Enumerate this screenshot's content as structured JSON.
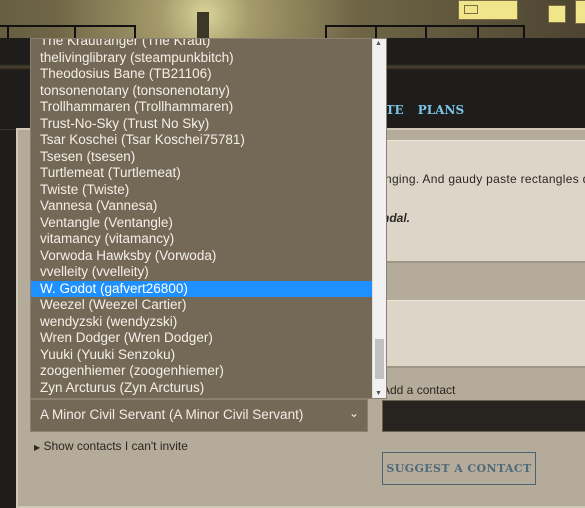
{
  "nav": {
    "items": [
      "ITE",
      "PLANS"
    ]
  },
  "content": {
    "paragraph": "inging. And gaudy paste rectangles di",
    "bold_text": "ndal.",
    "add_contact_label": "Add a contact",
    "suggest_button": "SUGGEST A CONTACT"
  },
  "dropdown": {
    "options": [
      "The Krautranger (The Kraut)",
      "thelivinglibrary (steampunkbitch)",
      "Theodosius Bane (TB21106)",
      "tonsonenotany (tonsonenotany)",
      "Trollhammaren (Trollhammaren)",
      "Trust-No-Sky (Trust No Sky)",
      "Tsar Koschei (Tsar Koschei75781)",
      "Tsesen (tsesen)",
      "Turtlemeat (Turtlemeat)",
      "Twiste (Twiste)",
      "Vannesa (Vannesa)",
      "Ventangle (Ventangle)",
      "vitamancy (vitamancy)",
      "Vorwoda Hawksby (Vorwoda)",
      "vvelleity (vvelleity)",
      "W. Godot (gafvert26800)",
      "Weezel (Weezel Cartier)",
      "wendyzski (wendyzski)",
      "Wren Dodger (Wren Dodger)",
      "Yuuki (Yuuki Senzoku)",
      "zoogenhiemer (zoogenhiemer)",
      "Zyn Arcturus (Zyn Arcturus)"
    ],
    "highlighted_index": 15,
    "scroll_position": 0.97,
    "highlight_color": "#1e90ff"
  },
  "select": {
    "value": "A Minor Civil Servant (A Minor Civil Servant)",
    "chevron": "chevron-down-icon"
  },
  "show_contacts": "Show contacts I can't invite"
}
